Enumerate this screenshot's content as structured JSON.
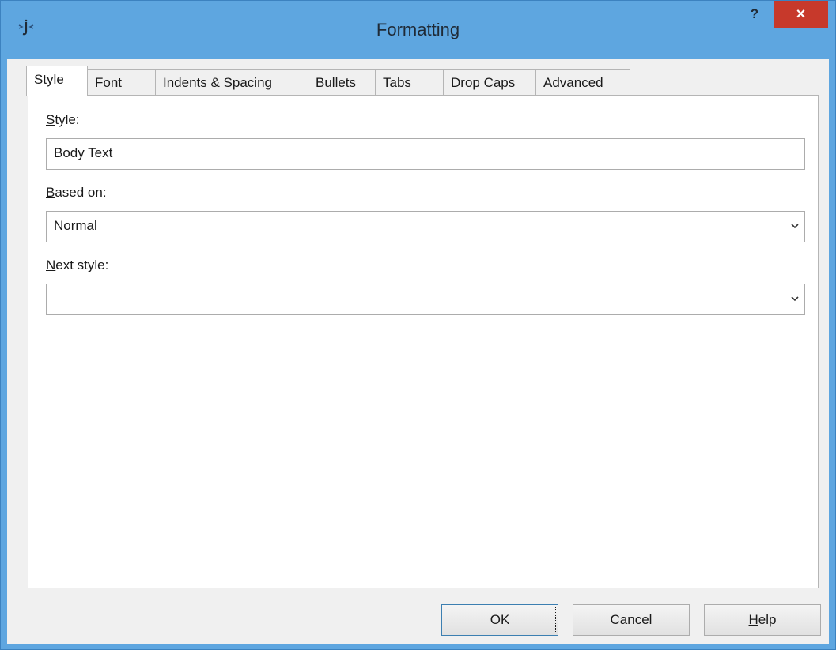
{
  "window": {
    "title": "Formatting",
    "help_glyph": "?",
    "close_glyph": "×"
  },
  "tabs": [
    {
      "label": "Style",
      "active": true
    },
    {
      "label": "Font",
      "active": false
    },
    {
      "label": "Indents & Spacing",
      "active": false
    },
    {
      "label": "Bullets",
      "active": false
    },
    {
      "label": "Tabs",
      "active": false
    },
    {
      "label": "Drop Caps",
      "active": false
    },
    {
      "label": "Advanced",
      "active": false
    }
  ],
  "style_tab": {
    "style_label_accel": "S",
    "style_label_rest": "tyle:",
    "style_value": "Body Text",
    "based_on_label_accel": "B",
    "based_on_label_rest": "ased on:",
    "based_on_value": "Normal",
    "next_style_label_accel": "N",
    "next_style_label_rest": "ext style:",
    "next_style_value": ""
  },
  "buttons": {
    "ok": "OK",
    "cancel": "Cancel",
    "help_accel": "H",
    "help_rest": "elp"
  },
  "colors": {
    "titlebar": "#5ea6e0",
    "close": "#c7392b",
    "client": "#f0f0f0"
  }
}
